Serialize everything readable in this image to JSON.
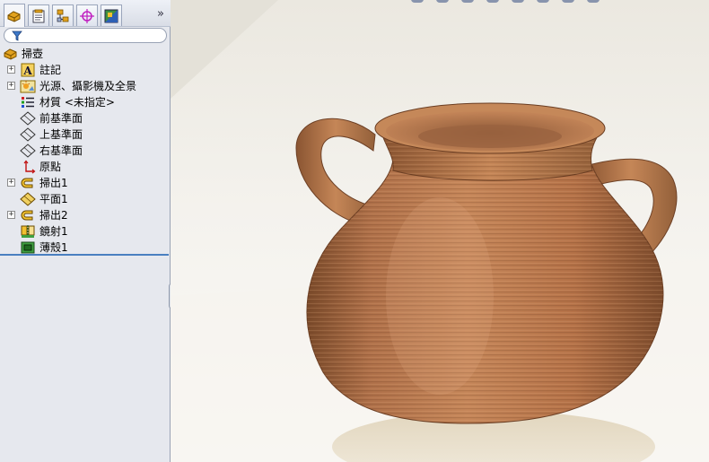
{
  "panel_tabs": [
    {
      "icon": "feature-manager-icon",
      "active": true
    },
    {
      "icon": "property-manager-icon",
      "active": false
    },
    {
      "icon": "configuration-manager-icon",
      "active": false
    },
    {
      "icon": "dimxpert-manager-icon",
      "active": false
    },
    {
      "icon": "display-manager-icon",
      "active": false
    }
  ],
  "more_tabs_glyph": "»",
  "filter_icon": "funnel-icon",
  "tree": {
    "root_label": "掃壺",
    "items": [
      {
        "label": "註記",
        "icon": "annotations-icon",
        "expandable": true
      },
      {
        "label": "光源、攝影機及全景",
        "icon": "lights-cameras-icon",
        "expandable": true
      },
      {
        "label": "材質 <未指定>",
        "icon": "material-icon",
        "expandable": false
      },
      {
        "label": "前基準面",
        "icon": "plane-icon",
        "expandable": false
      },
      {
        "label": "上基準面",
        "icon": "plane-icon",
        "expandable": false
      },
      {
        "label": "右基準面",
        "icon": "plane-icon",
        "expandable": false
      },
      {
        "label": "原點",
        "icon": "origin-icon",
        "expandable": false
      },
      {
        "label": "掃出1",
        "icon": "sweep-icon",
        "expandable": true
      },
      {
        "label": "平面1",
        "icon": "ref-plane-icon",
        "expandable": false
      },
      {
        "label": "掃出2",
        "icon": "sweep-icon",
        "expandable": true
      },
      {
        "label": "鏡射1",
        "icon": "mirror-icon",
        "expandable": false
      },
      {
        "label": "薄殼1",
        "icon": "shell-icon",
        "expandable": false
      }
    ]
  },
  "expand_glyph": "+",
  "viewport": {
    "model": "vase-with-two-handles",
    "material_color": "#b8754a",
    "background_color": "#f3f1ec"
  }
}
